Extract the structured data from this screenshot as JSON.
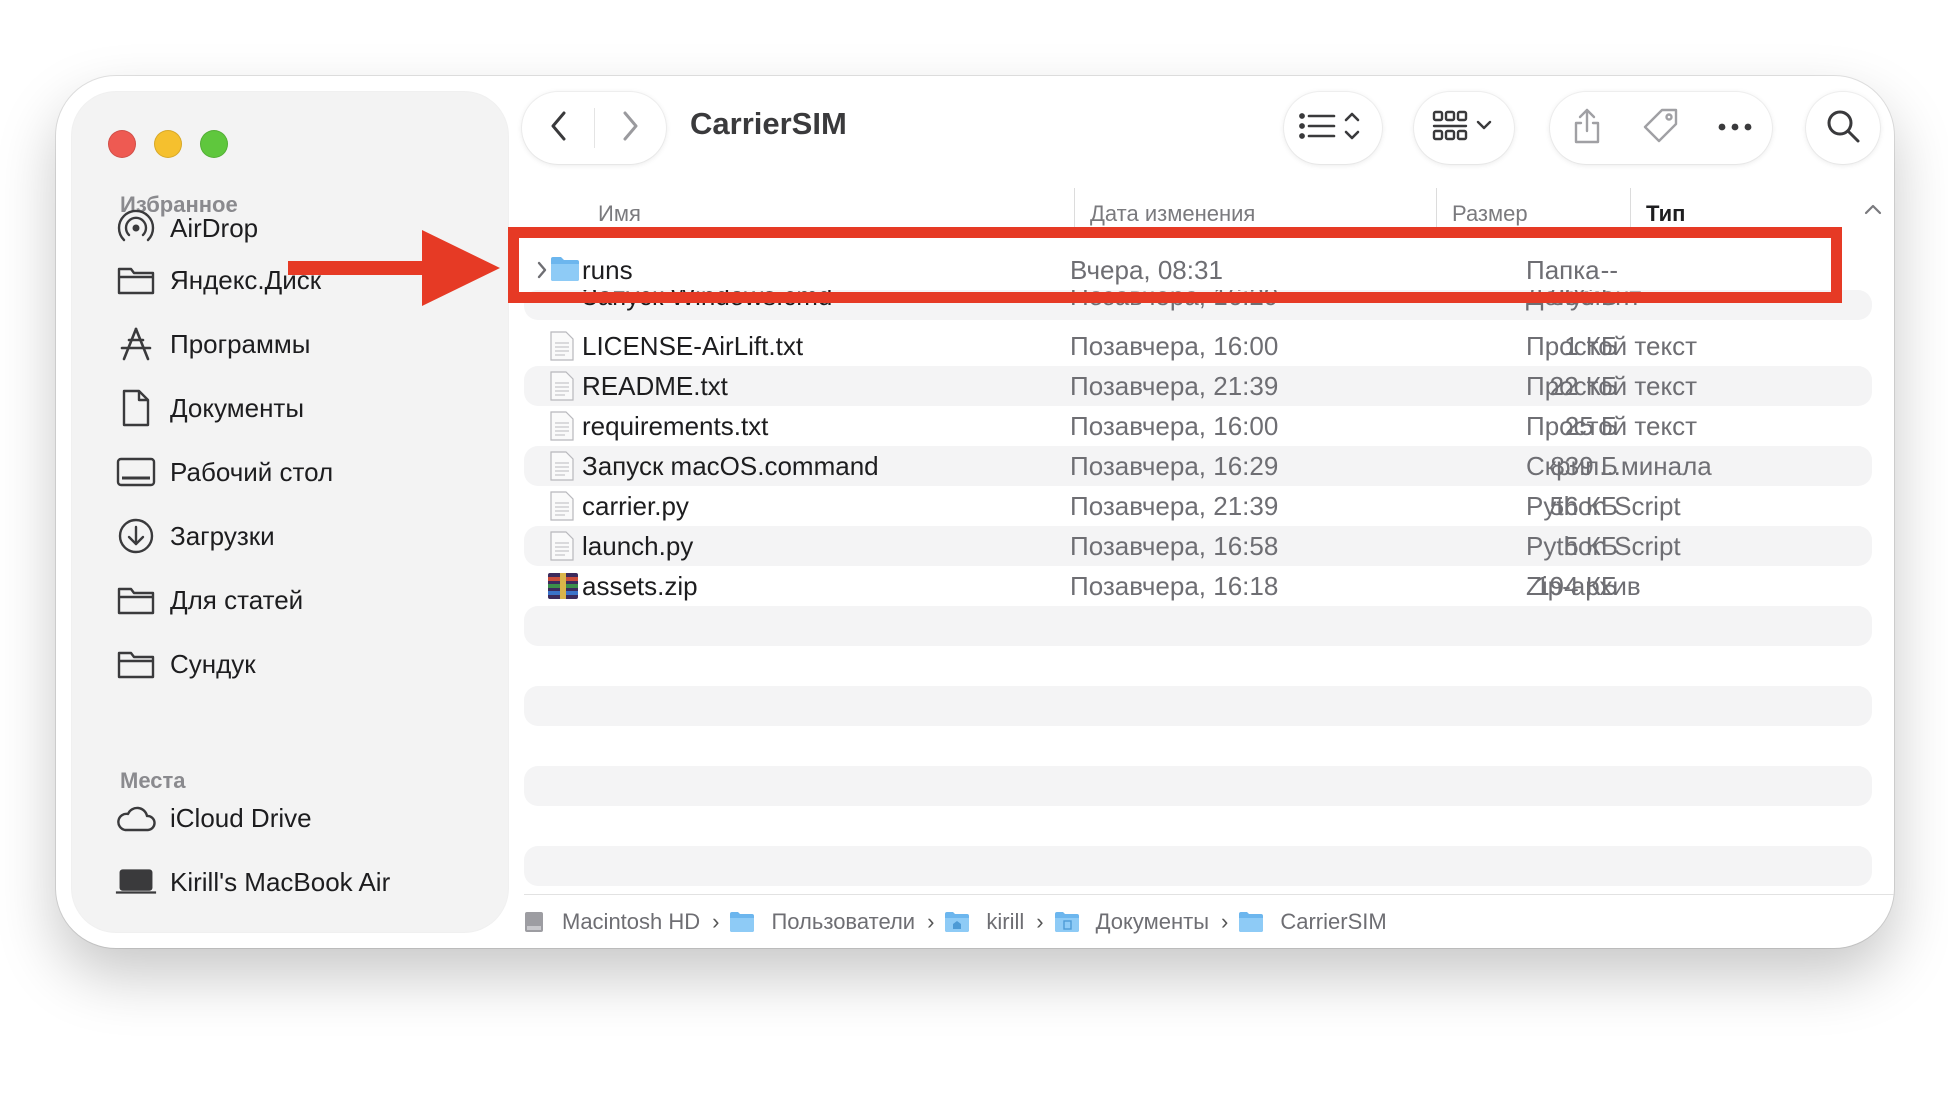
{
  "window": {
    "title": "CarrierSIM"
  },
  "sidebar": {
    "sections": [
      {
        "label": "Избранное"
      },
      {
        "label": "Места"
      }
    ],
    "favorites": [
      {
        "label": "AirDrop",
        "icon": "airdrop-icon"
      },
      {
        "label": "Яндекс.Диск",
        "icon": "folder-icon"
      },
      {
        "label": "Программы",
        "icon": "applications-icon"
      },
      {
        "label": "Документы",
        "icon": "document-icon"
      },
      {
        "label": "Рабочий стол",
        "icon": "desktop-icon"
      },
      {
        "label": "Загрузки",
        "icon": "downloads-icon"
      },
      {
        "label": "Для статей",
        "icon": "folder-icon"
      },
      {
        "label": "Сундук",
        "icon": "folder-icon"
      }
    ],
    "locations": [
      {
        "label": "iCloud Drive",
        "icon": "cloud-icon"
      },
      {
        "label": "Kirill's MacBook Air",
        "icon": "laptop-icon"
      }
    ]
  },
  "toolbar": {
    "back_icon": "chevron-left-icon",
    "forward_icon": "chevron-right-icon",
    "view_icon": "list-view-icon",
    "group_icon": "grid-group-icon",
    "share_icon": "share-icon",
    "tag_icon": "tag-icon",
    "more_icon": "ellipsis-icon",
    "search_icon": "search-icon"
  },
  "columns": {
    "name": "Имя",
    "date": "Дата изменения",
    "size": "Размер",
    "type": "Тип"
  },
  "files": [
    {
      "name": "runs",
      "date": "Вчера, 08:31",
      "size": "--",
      "type": "Папка",
      "kind": "folder"
    },
    {
      "name": "Запуск Windows.cmd",
      "date": "Позавчера, 16:29",
      "size": "396 Б",
      "type": "Документ",
      "kind": "document"
    },
    {
      "name": "LICENSE-AirLift.txt",
      "date": "Позавчера, 16:00",
      "size": "1 КБ",
      "type": "Простой текст",
      "kind": "document"
    },
    {
      "name": "README.txt",
      "date": "Позавчера, 21:39",
      "size": "22 КБ",
      "type": "Простой текст",
      "kind": "document"
    },
    {
      "name": "requirements.txt",
      "date": "Позавчера, 16:00",
      "size": "25 Б",
      "type": "Простой текст",
      "kind": "document"
    },
    {
      "name": "Запуск macOS.command",
      "date": "Позавчера, 16:29",
      "size": "839 Б",
      "type": "Скрип...минала",
      "kind": "document"
    },
    {
      "name": "carrier.py",
      "date": "Позавчера, 21:39",
      "size": "56 КБ",
      "type": "Python Script",
      "kind": "document"
    },
    {
      "name": "launch.py",
      "date": "Позавчера, 16:58",
      "size": "5 КБ",
      "type": "Python Script",
      "kind": "document"
    },
    {
      "name": "assets.zip",
      "date": "Позавчера, 16:18",
      "size": "194 КБ",
      "type": "Zip-архив",
      "kind": "zip"
    }
  ],
  "path_bar": [
    {
      "label": "Macintosh HD",
      "icon": "disk-icon"
    },
    {
      "label": "Пользователи",
      "icon": "folder-icon"
    },
    {
      "label": "kirill",
      "icon": "home-folder-icon"
    },
    {
      "label": "Документы",
      "icon": "folder-icon"
    },
    {
      "label": "CarrierSIM",
      "icon": "folder-icon"
    }
  ],
  "annotation": {
    "color": "#e63a25"
  }
}
